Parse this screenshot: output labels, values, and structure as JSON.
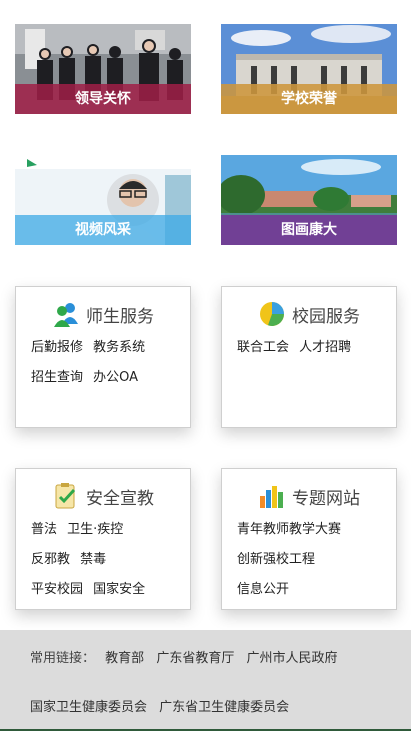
{
  "tiles": [
    {
      "label": "领导关怀",
      "image": "leaders-visit-photo"
    },
    {
      "label": "学校荣誉",
      "image": "school-building-photo"
    },
    {
      "label": "视频风采",
      "image": "video-still-photo"
    },
    {
      "label": "图画康大",
      "image": "campus-lake-photo"
    }
  ],
  "boxes": {
    "teacher_student": {
      "title": "师生服务",
      "icon": "users-icon",
      "links": [
        "后勤报修",
        "教务系统",
        "招生查询",
        "办公OA"
      ]
    },
    "campus": {
      "title": "校园服务",
      "icon": "pie-chart-icon",
      "links": [
        "联合工会",
        "人才招聘"
      ]
    },
    "safety": {
      "title": "安全宣教",
      "icon": "checklist-icon",
      "links": [
        "普法",
        "卫生·疾控",
        "反邪教",
        "禁毒",
        "平安校园",
        "国家安全"
      ]
    },
    "special": {
      "title": "专题网站",
      "icon": "bar-chart-icon",
      "links": [
        "青年教师教学大赛",
        "创新强校工程",
        "信息公开"
      ]
    }
  },
  "footer": {
    "label": "常用链接：",
    "links": [
      "教育部",
      "广东省教育厅",
      "广州市人民政府",
      "国家卫生健康委员会",
      "广东省卫生健康委员会"
    ]
  },
  "colors": {
    "caption_red": "#a01e46",
    "caption_gold": "#cd963c",
    "caption_blue": "#3caae6",
    "caption_purple": "#783296",
    "footer_bg": "#dcdcdc"
  }
}
